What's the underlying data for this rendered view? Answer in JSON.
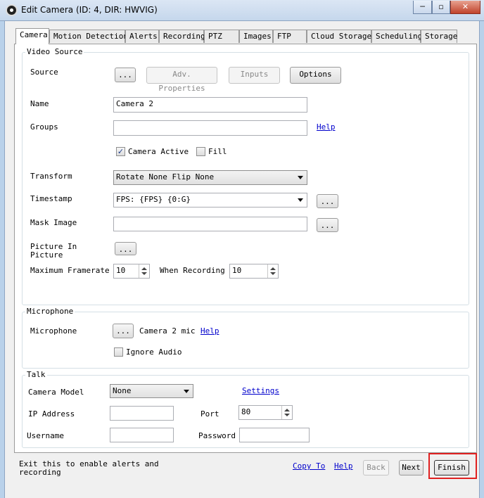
{
  "window": {
    "title": "Edit Camera (ID: 4, DIR: HWVIG)",
    "minimize_glyph": "─",
    "restore_glyph": "▫",
    "close_glyph": "✕"
  },
  "tabs": [
    {
      "label": "Camera",
      "active": true
    },
    {
      "label": "Motion Detection"
    },
    {
      "label": "Alerts"
    },
    {
      "label": "Recording"
    },
    {
      "label": "PTZ"
    },
    {
      "label": "Images"
    },
    {
      "label": "FTP"
    },
    {
      "label": "Cloud Storage"
    },
    {
      "label": "Scheduling"
    },
    {
      "label": "Storage"
    }
  ],
  "video_source": {
    "title": "Video Source",
    "source_label": "Source",
    "browse_label": "...",
    "adv_properties_label": "Adv. Properties",
    "inputs_label": "Inputs",
    "options_label": "Options",
    "name_label": "Name",
    "name_value": "Camera 2",
    "groups_label": "Groups",
    "groups_value": "",
    "help_label": "Help",
    "camera_active_label": "Camera Active",
    "camera_active_checked": true,
    "fill_label": "Fill",
    "fill_checked": false,
    "transform_label": "Transform",
    "transform_value": "Rotate None Flip None",
    "timestamp_label": "Timestamp",
    "timestamp_value": "FPS: {FPS} {0:G}",
    "timestamp_browse": "...",
    "mask_image_label": "Mask Image",
    "mask_image_value": "",
    "mask_browse": "...",
    "pip_label_1": "Picture In",
    "pip_label_2": "Picture",
    "pip_browse": "...",
    "max_framerate_label": "Maximum Framerate",
    "max_framerate_value": "10",
    "when_recording_label": "When Recording",
    "when_recording_value": "10"
  },
  "microphone": {
    "title": "Microphone",
    "label": "Microphone",
    "browse_label": "...",
    "device_name": "Camera 2 mic",
    "help_label": "Help",
    "ignore_audio_label": "Ignore Audio",
    "ignore_audio_checked": false
  },
  "talk": {
    "title": "Talk",
    "camera_model_label": "Camera Model",
    "camera_model_value": "None",
    "settings_label": "Settings",
    "ip_label": "IP Address",
    "ip_value": "",
    "port_label": "Port",
    "port_value": "80",
    "username_label": "Username",
    "username_value": "",
    "password_label": "Password",
    "password_value": ""
  },
  "footer": {
    "hint_line1": "Exit this to enable alerts and",
    "hint_line2": "recording",
    "copy_to_label": "Copy To",
    "help_label": "Help",
    "back_label": "Back",
    "next_label": "Next",
    "finish_label": "Finish"
  },
  "colors": {
    "highlight": "#e02020",
    "link": "#0000cc",
    "titlebar": "#c5d7ec"
  }
}
